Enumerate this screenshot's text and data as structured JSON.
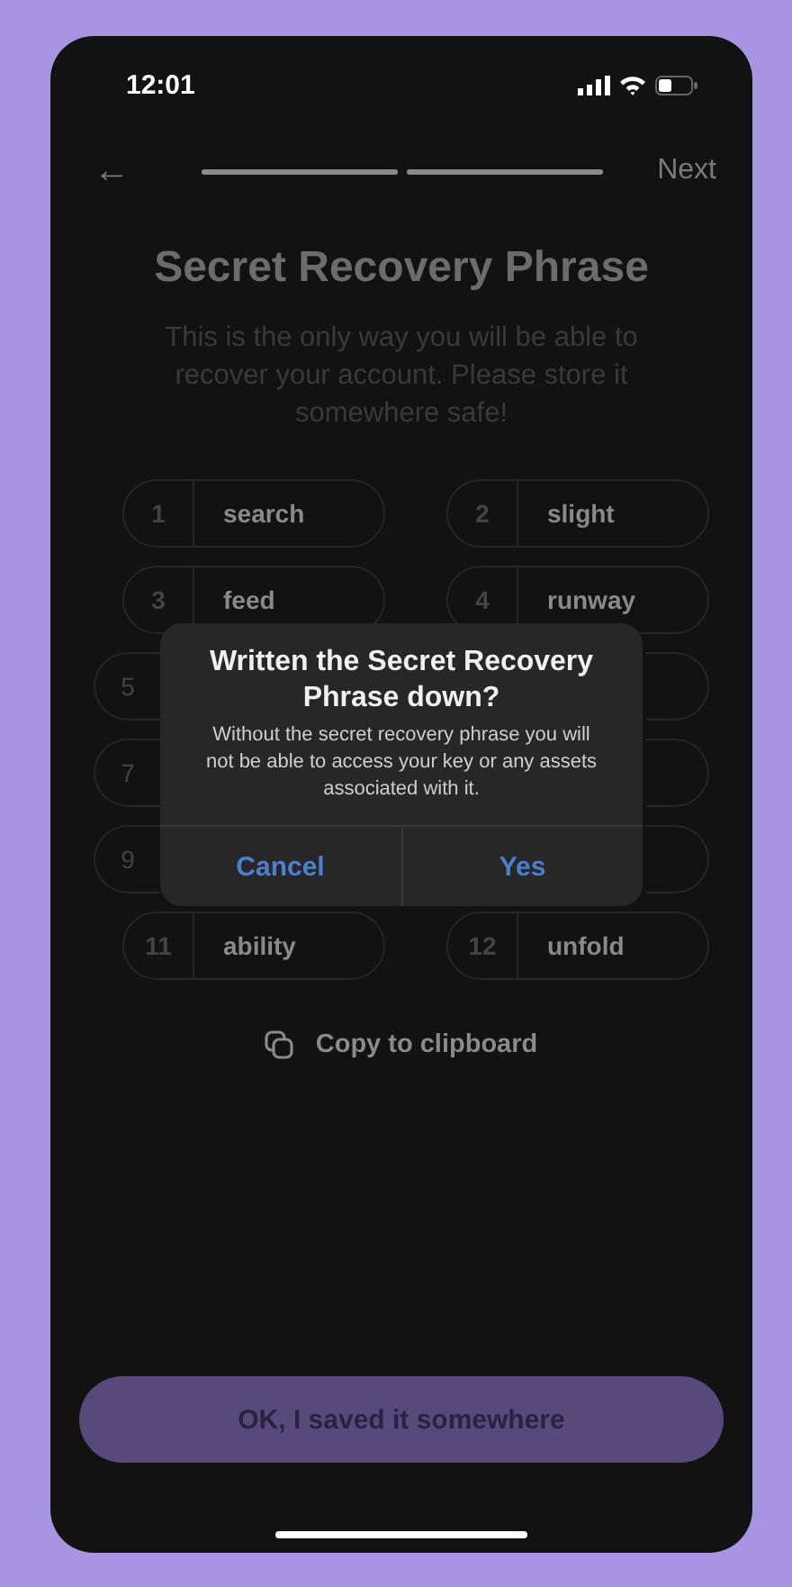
{
  "status_bar": {
    "time": "12:01"
  },
  "nav": {
    "back": "←",
    "next": "Next",
    "progress": [
      {
        "level": 1
      },
      {
        "level": 1
      }
    ]
  },
  "title": "Secret Recovery Phrase",
  "subtitle": "This is the only way you will be able to recover your account. Please store it somewhere safe!",
  "words": [
    {
      "kind": "word",
      "number": "1",
      "word": "search"
    },
    {
      "kind": "word",
      "number": "2",
      "word": "slight"
    },
    {
      "kind": "word",
      "number": "3",
      "word": "feed"
    },
    {
      "kind": "word",
      "number": "4",
      "word": "runway"
    },
    {
      "kind": "partial",
      "number": "5"
    },
    {
      "kind": "covered"
    },
    {
      "kind": "partial",
      "number": "7"
    },
    {
      "kind": "covered"
    },
    {
      "kind": "partial",
      "number": "9"
    },
    {
      "kind": "covered"
    },
    {
      "kind": "word",
      "number": "11",
      "word": "ability"
    },
    {
      "kind": "word",
      "number": "12",
      "word": "unfold"
    }
  ],
  "copy": "Copy to clipboard",
  "primary_button": "OK, I saved it somewhere",
  "dialog": {
    "title": "Written the Secret Recovery Phrase down?",
    "message": "Without the secret recovery phrase you will not be able to access your key or any assets associated with it.",
    "buttons": [
      "Cancel",
      "Yes"
    ]
  }
}
